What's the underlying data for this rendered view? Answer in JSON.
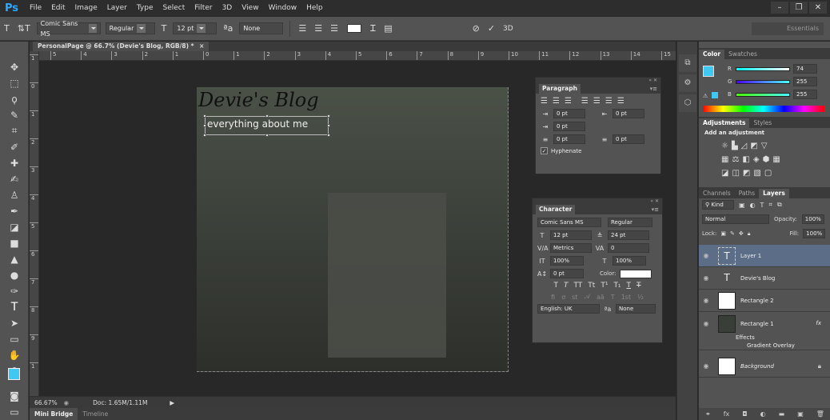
{
  "app": {
    "logo": "Ps"
  },
  "menu": [
    "File",
    "Edit",
    "Image",
    "Layer",
    "Type",
    "Select",
    "Filter",
    "3D",
    "View",
    "Window",
    "Help"
  ],
  "options": {
    "font_family": "Comic Sans MS",
    "font_style": "Regular",
    "font_size": "12 pt",
    "antialias": "None",
    "mode_3d": "3D",
    "workspace": "Essentials"
  },
  "document": {
    "tab_title": "PersonalPage @ 66.7% (Devie's Blog, RGB/8) *",
    "title_text": "Devie's Blog",
    "subtitle_text": "everything about me"
  },
  "rulers": {
    "h": [
      "5",
      "4",
      "3",
      "2",
      "1",
      "0",
      "1",
      "2",
      "3",
      "4",
      "5",
      "6",
      "7",
      "8",
      "9",
      "10",
      "11",
      "12",
      "13",
      "14",
      "15"
    ],
    "v": [
      "1",
      "0",
      "1",
      "2",
      "3",
      "4",
      "5",
      "6",
      "7",
      "8",
      "9",
      "1"
    ]
  },
  "paragraph": {
    "title": "Paragraph",
    "indent_left": "0 pt",
    "indent_right": "0 pt",
    "indent_first": "0 pt",
    "space_before": "0 pt",
    "space_after": "0 pt",
    "hyphenate_label": "Hyphenate"
  },
  "character": {
    "title": "Character",
    "font_family": "Comic Sans MS",
    "font_style": "Regular",
    "size": "12 pt",
    "leading": "24 pt",
    "kerning": "Metrics",
    "tracking": "0",
    "vscale": "100%",
    "hscale": "100%",
    "baseline": "0 pt",
    "color_label": "Color:",
    "language": "English: UK",
    "antialias": "None"
  },
  "color_panel": {
    "tabs": [
      "Color",
      "Swatches"
    ],
    "r": "74",
    "g": "255",
    "b": "255"
  },
  "adjustments": {
    "tabs": [
      "Adjustments",
      "Styles"
    ],
    "heading": "Add an adjustment"
  },
  "layers_panel": {
    "tabs": [
      "Channels",
      "Paths",
      "Layers"
    ],
    "kind": "Kind",
    "blend_mode": "Normal",
    "opacity_label": "Opacity:",
    "opacity": "100%",
    "lock_label": "Lock:",
    "fill_label": "Fill:",
    "fill": "100%",
    "layers": [
      "Layer 1",
      "Devie's Blog",
      "Rectangle 2",
      "Rectangle 1",
      "Background"
    ],
    "effects_label": "Effects",
    "gradient_overlay": "Gradient Overlay",
    "fx": "fx"
  },
  "status": {
    "zoom": "66.67%",
    "doc": "Doc: 1.65M/1.11M"
  },
  "bottom": {
    "tabs": [
      "Mini Bridge",
      "Timeline"
    ]
  },
  "colors": {
    "foreground": "#3ec8f2",
    "background": "#ffffff",
    "accent": "#2fa8ff"
  }
}
